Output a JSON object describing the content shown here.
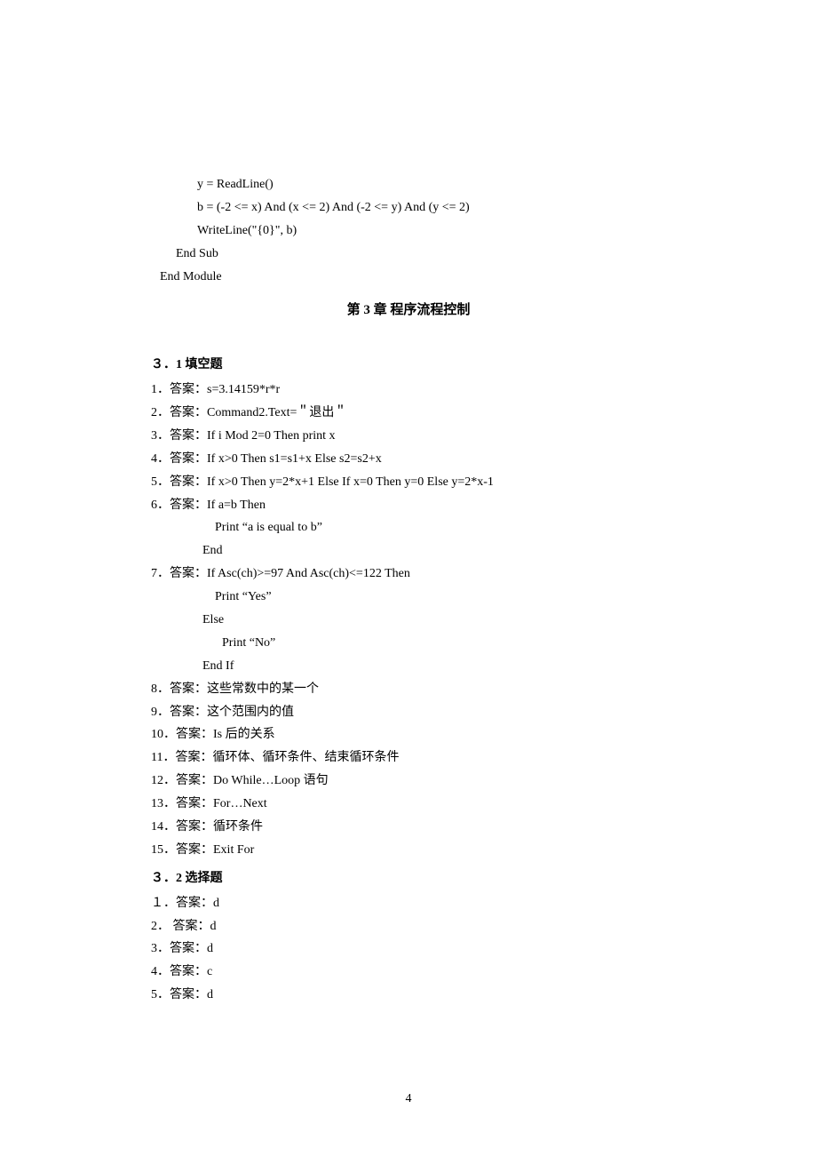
{
  "code_tail": {
    "l1": "y = ReadLine()",
    "l2": "b = (-2 <= x) And (x <= 2) And (-2 <= y) And (y <= 2)",
    "l3": "WriteLine(\"{0}\", b)",
    "l4": "End Sub",
    "l5": "End Module"
  },
  "chapter": "第 3 章   程序流程控制",
  "sec_fill": "３．1 填空题",
  "fill": {
    "a1": "1．答案：s=3.14159*r*r",
    "a2": "2．答案：Command2.Text=＂退出＂",
    "a3": "3．答案：If i Mod 2=0 Then print x",
    "a4": "4．答案：If x>0 Then s1=s1+x Else s2=s2+x",
    "a5": "5．答案：If x>0 Then y=2*x+1 Else If x=0 Then y=0 Else y=2*x-1",
    "a6": "6．答案：If a=b Then",
    "a6b": "Print “a is equal to b”",
    "a6c": "End",
    "a7": "7．答案：If Asc(ch)>=97 And Asc(ch)<=122 Then",
    "a7b": "Print “Yes”",
    "a7c": "Else",
    "a7d": "Print “No”",
    "a7e": "End If",
    "a8": "8．答案：这些常数中的某一个",
    "a9": "9．答案：这个范围内的值",
    "a10": "10．答案：Is 后的关系",
    "a11": "11．答案：循环体、循环条件、结束循环条件",
    "a12": "12．答案：Do While…Loop 语句",
    "a13": "13．答案：For…Next",
    "a14": "14．答案：循环条件",
    "a15": "15．答案：Exit For"
  },
  "sec_choice": "３．2 选择题",
  "choice": {
    "c1": "１．答案：d",
    "c2": "2． 答案：d",
    "c3": "3．答案：d",
    "c4": "4．答案：c",
    "c5": "5．答案：d"
  },
  "page_number": "4"
}
